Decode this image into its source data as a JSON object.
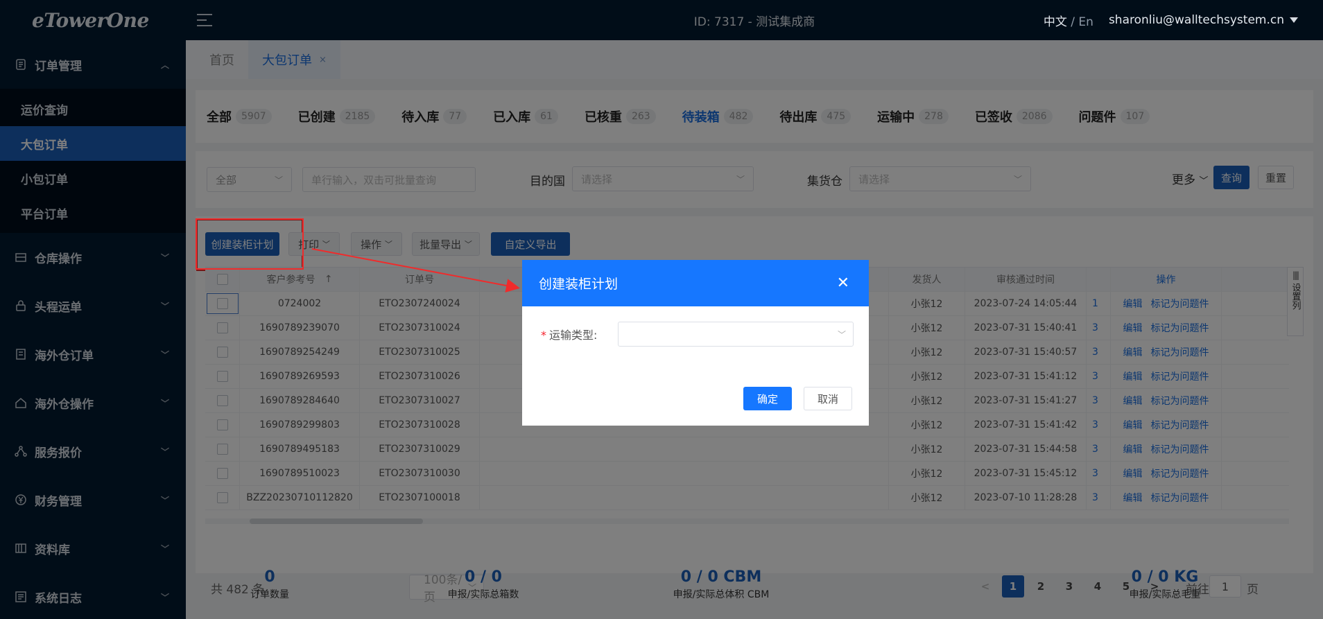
{
  "app": {
    "logo": "eTowerOne",
    "header_title": "ID: 7317 - 测试集成商",
    "lang_current": "中文",
    "lang_sep": "/",
    "lang_alt": "En",
    "user_email": "sharonliu@walltechsystem.cn"
  },
  "sidebar": {
    "groups": [
      {
        "label": "订单管理",
        "caret": "^"
      },
      {
        "label": "仓库操作",
        "caret": "v"
      },
      {
        "label": "头程运单",
        "caret": "v"
      },
      {
        "label": "海外仓订单",
        "caret": "v"
      },
      {
        "label": "海外仓操作",
        "caret": "v"
      },
      {
        "label": "服务报价",
        "caret": "v"
      },
      {
        "label": "财务管理",
        "caret": "v"
      },
      {
        "label": "资料库",
        "caret": "v"
      },
      {
        "label": "系统日志",
        "caret": "v"
      }
    ],
    "subitems": [
      "运价查询",
      "大包订单",
      "小包订单",
      "平台订单"
    ]
  },
  "tabs": [
    {
      "label": "首页"
    },
    {
      "label": "大包订单",
      "close": "×"
    }
  ],
  "statuses": [
    {
      "label": "全部",
      "count": "5907"
    },
    {
      "label": "已创建",
      "count": "2185"
    },
    {
      "label": "待入库",
      "count": "77"
    },
    {
      "label": "已入库",
      "count": "61"
    },
    {
      "label": "已核重",
      "count": "263"
    },
    {
      "label": "待装箱",
      "count": "482"
    },
    {
      "label": "待出库",
      "count": "475"
    },
    {
      "label": "运输中",
      "count": "278"
    },
    {
      "label": "已签收",
      "count": "2086"
    },
    {
      "label": "问题件",
      "count": "107"
    }
  ],
  "filters": {
    "type_select": "全部",
    "search_placeholder": "单行输入，双击可批量查询",
    "dest_label": "目的国",
    "dest_placeholder": "请选择",
    "wh_label": "集货仓",
    "wh_placeholder": "请选择",
    "more": "更多",
    "query": "查询",
    "reset": "重置"
  },
  "toolbar": {
    "create_plan": "创建装柜计划",
    "print": "打印",
    "operate": "操作",
    "batch_export": "批量导出",
    "custom_export": "自定义导出"
  },
  "table": {
    "headers": {
      "ref": "客户参考号",
      "sort": "↑",
      "order": "订单号",
      "shipper": "发货人",
      "time": "审核通过时间",
      "ops": "操作"
    },
    "rows": [
      {
        "ref": "0724002",
        "order": "ETO2307240024",
        "shipper": "小张12",
        "time": "2023-07-24 14:05:44",
        "x": "1",
        "edit": "编辑",
        "mark": "标记为问题件"
      },
      {
        "ref": "1690789239070",
        "order": "ETO2307310024",
        "shipper": "小张12",
        "time": "2023-07-31 15:40:41",
        "x": "3",
        "edit": "编辑",
        "mark": "标记为问题件"
      },
      {
        "ref": "1690789254249",
        "order": "ETO2307310025",
        "shipper": "小张12",
        "time": "2023-07-31 15:40:57",
        "x": "3",
        "edit": "编辑",
        "mark": "标记为问题件"
      },
      {
        "ref": "1690789269593",
        "order": "ETO2307310026",
        "shipper": "小张12",
        "time": "2023-07-31 15:41:12",
        "x": "3",
        "edit": "编辑",
        "mark": "标记为问题件"
      },
      {
        "ref": "1690789284640",
        "order": "ETO2307310027",
        "shipper": "小张12",
        "time": "2023-07-31 15:41:27",
        "x": "3",
        "edit": "编辑",
        "mark": "标记为问题件"
      },
      {
        "ref": "1690789299803",
        "order": "ETO2307310028",
        "shipper": "小张12",
        "time": "2023-07-31 15:41:42",
        "x": "3",
        "edit": "编辑",
        "mark": "标记为问题件"
      },
      {
        "ref": "1690789495183",
        "order": "ETO2307310029",
        "shipper": "小张12",
        "time": "2023-07-31 15:44:58",
        "x": "3",
        "edit": "编辑",
        "mark": "标记为问题件"
      },
      {
        "ref": "1690789510023",
        "order": "ETO2307310030",
        "shipper": "小张12",
        "time": "2023-07-31 15:45:12",
        "x": "3",
        "edit": "编辑",
        "mark": "标记为问题件"
      },
      {
        "ref": "BZZ20230710112820",
        "order": "ETO2307100018",
        "shipper": "小张12",
        "time": "2023-07-10 11:28:28",
        "x": "3",
        "edit": "编辑",
        "mark": "标记为问题件"
      }
    ],
    "settings_icon": "||||",
    "settings_label": "设置列"
  },
  "pager": {
    "total": "共 482 条",
    "page_size": "100条/页",
    "prev": "<",
    "next": ">",
    "pages": [
      "1",
      "2",
      "3",
      "4",
      "5"
    ],
    "goto_label": "前往",
    "goto_value": "1",
    "goto_unit": "页"
  },
  "stats": [
    {
      "value": "0",
      "label": "订单数量"
    },
    {
      "value": "0 / 0",
      "label": "申报/实际总箱数"
    },
    {
      "value": "0 / 0 CBM",
      "label": "申报/实际总体积 CBM"
    },
    {
      "value": "0 / 0 KG",
      "label": "申报/实际总毛重"
    }
  ],
  "modal": {
    "title": "创建装柜计划",
    "close": "✕",
    "required_mark": "*",
    "field_label": "运输类型:",
    "ok": "确定",
    "cancel": "取消"
  },
  "colors": {
    "sidebar_bg": "#031a30",
    "primary": "#1b5fb8",
    "modal_header": "#1677ff",
    "annotation_red": "#f02b2b"
  }
}
